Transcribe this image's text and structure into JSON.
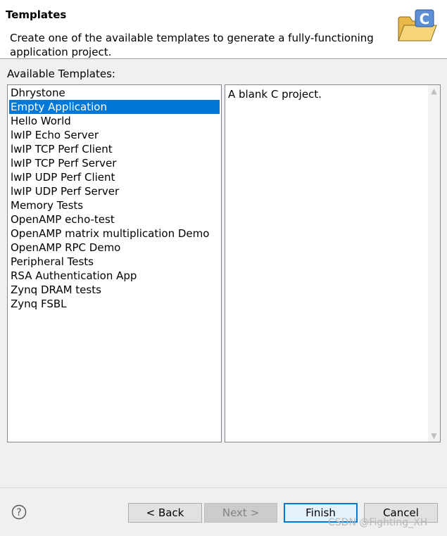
{
  "banner": {
    "title": "Templates",
    "description": "Create one of the available templates to generate a fully-functioning application project."
  },
  "available_label": "Available Templates:",
  "templates": [
    "Dhrystone",
    "Empty Application",
    "Hello World",
    "lwIP Echo Server",
    "lwIP TCP Perf Client",
    "lwIP TCP Perf Server",
    "lwIP UDP Perf Client",
    "lwIP UDP Perf Server",
    "Memory Tests",
    "OpenAMP echo-test",
    "OpenAMP matrix multiplication Demo",
    "OpenAMP RPC Demo",
    "Peripheral Tests",
    "RSA Authentication App",
    "Zynq DRAM tests",
    "Zynq FSBL"
  ],
  "selected_template": "Empty Application",
  "description_text": "A blank C project.",
  "buttons": {
    "back": "< Back",
    "next": "Next >",
    "finish": "Finish",
    "cancel": "Cancel"
  },
  "watermark": "CSDN @Fighting_XH",
  "colors": {
    "selection": "#0078d7",
    "background": "#f0f0f0"
  }
}
